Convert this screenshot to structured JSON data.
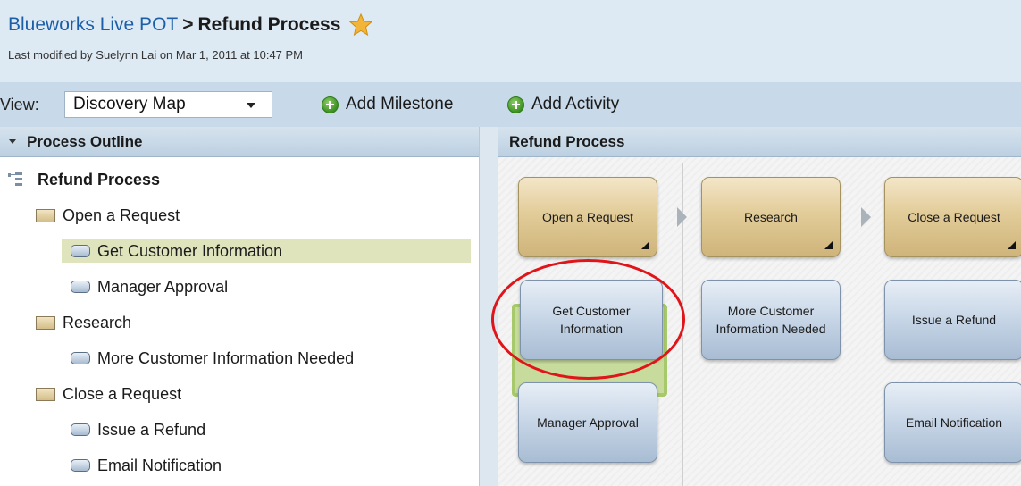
{
  "header": {
    "project_link": "Blueworks Live POT",
    "separator": ">",
    "title": "Refund Process",
    "last_modified": "Last modified by Suelynn Lai on Mar 1, 2011 at 10:47 PM"
  },
  "toolbar": {
    "view_label": "View:",
    "view_value": "Discovery Map",
    "add_milestone": "Add Milestone",
    "add_activity": "Add Activity"
  },
  "outline": {
    "header": "Process Outline",
    "root": "Refund Process",
    "milestones": [
      {
        "label": "Open a Request",
        "activities": [
          "Get Customer Information",
          "Manager Approval"
        ]
      },
      {
        "label": "Research",
        "activities": [
          "More Customer Information Needed"
        ]
      },
      {
        "label": "Close a Request",
        "activities": [
          "Issue a Refund",
          "Email Notification"
        ]
      }
    ]
  },
  "map": {
    "header": "Refund Process",
    "milestones": [
      "Open a Request",
      "Research",
      "Close a Request"
    ],
    "col1": [
      "Get Customer Information",
      "Manager Approval"
    ],
    "col2": [
      "More Customer Information Needed"
    ],
    "col3": [
      "Issue a Refund",
      "Email Notification"
    ]
  },
  "colors": {
    "link": "#1c5fa8",
    "selected_row": "#dfe4bd",
    "selection_border": "#a7c96b",
    "annotation": "#e0151a"
  }
}
